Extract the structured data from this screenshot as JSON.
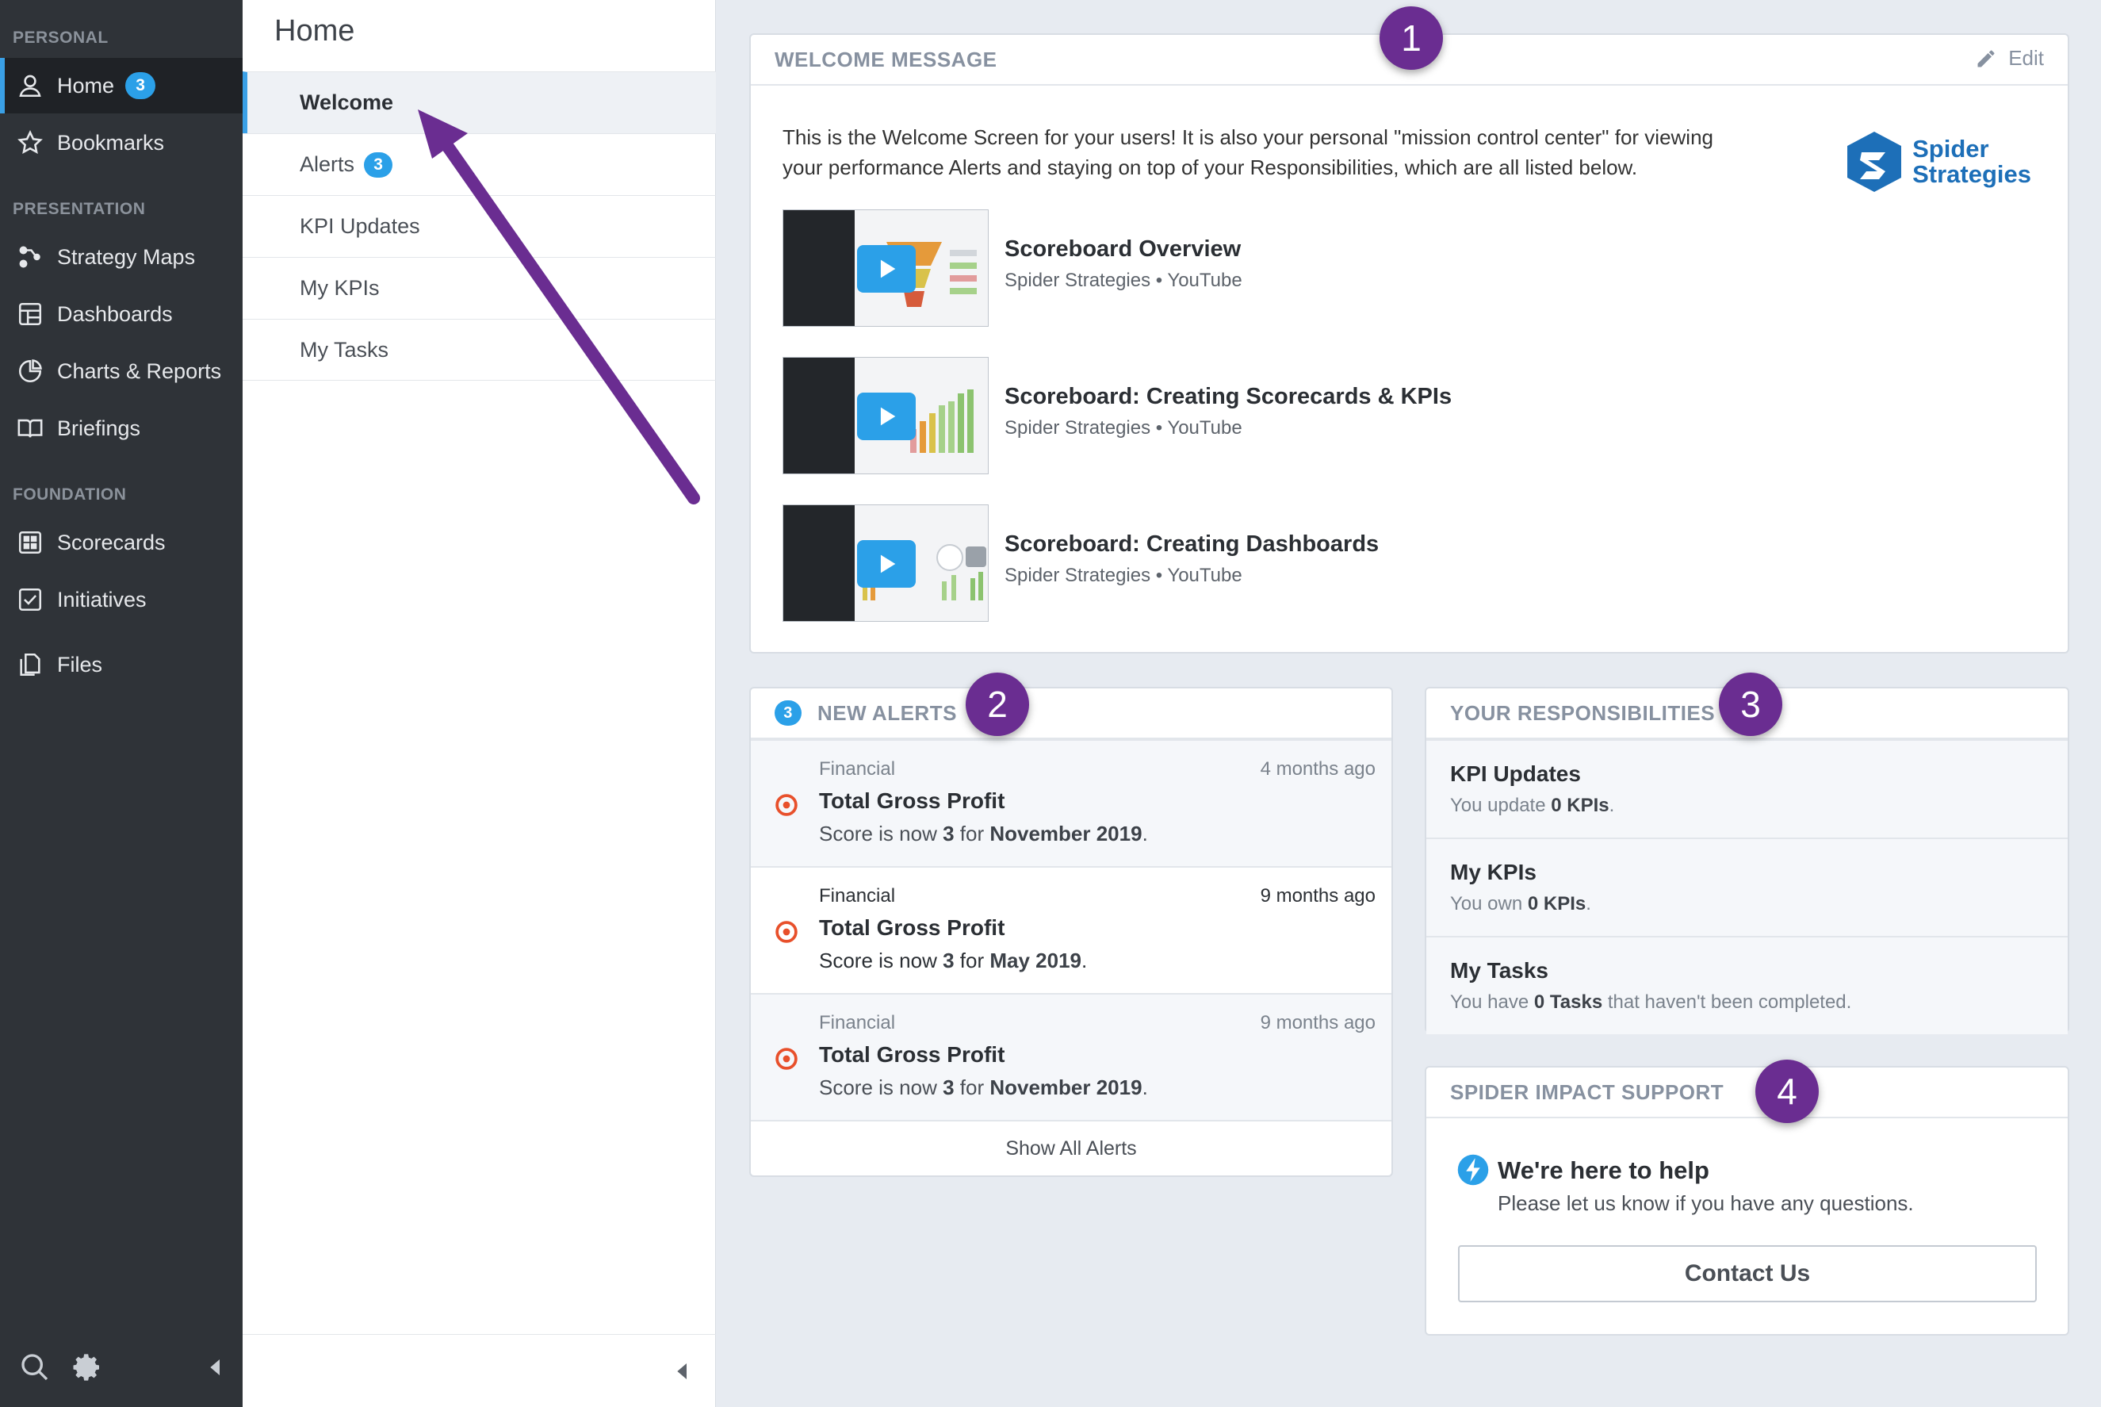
{
  "nav": {
    "sections": {
      "personal": "PERSONAL",
      "presentation": "PRESENTATION",
      "foundation": "FOUNDATION"
    },
    "items": {
      "home": {
        "label": "Home",
        "badge": "3"
      },
      "bookmarks": {
        "label": "Bookmarks"
      },
      "strategy_maps": {
        "label": "Strategy Maps"
      },
      "dashboards": {
        "label": "Dashboards"
      },
      "charts_reports": {
        "label": "Charts & Reports"
      },
      "briefings": {
        "label": "Briefings"
      },
      "scorecards": {
        "label": "Scorecards"
      },
      "initiatives": {
        "label": "Initiatives"
      },
      "files": {
        "label": "Files"
      }
    }
  },
  "subnav": {
    "title": "Home",
    "items": {
      "welcome": {
        "label": "Welcome"
      },
      "alerts": {
        "label": "Alerts",
        "badge": "3"
      },
      "kpi_updates": {
        "label": "KPI Updates"
      },
      "my_kpis": {
        "label": "My KPIs"
      },
      "my_tasks": {
        "label": "My Tasks"
      }
    }
  },
  "welcome": {
    "header": "WELCOME MESSAGE",
    "edit_label": "Edit",
    "text": "This is the Welcome Screen for your users!  It is also your personal \"mission control center\" for viewing your performance Alerts and staying on top of your Responsibilities, which are all listed below.",
    "logo": {
      "line1": "Spider",
      "line2": "Strategies"
    },
    "videos": [
      {
        "title": "Scoreboard Overview",
        "source": "Spider Strategies • YouTube"
      },
      {
        "title": "Scoreboard: Creating Scorecards & KPIs",
        "source": "Spider Strategies • YouTube"
      },
      {
        "title": "Scoreboard: Creating Dashboards",
        "source": "Spider Strategies • YouTube"
      }
    ]
  },
  "alerts": {
    "badge": "3",
    "header": "NEW ALERTS",
    "items": [
      {
        "category": "Financial",
        "time": "4 months ago",
        "title": "Total Gross Profit",
        "score_prefix": "Score is now ",
        "score": "3",
        "score_mid": " for ",
        "period": "November 2019",
        "score_suffix": "."
      },
      {
        "category": "Financial",
        "time": "9 months ago",
        "title": "Total Gross Profit",
        "score_prefix": "Score is now ",
        "score": "3",
        "score_mid": " for ",
        "period": "May 2019",
        "score_suffix": "."
      },
      {
        "category": "Financial",
        "time": "9 months ago",
        "title": "Total Gross Profit",
        "score_prefix": "Score is now ",
        "score": "3",
        "score_mid": " for ",
        "period": "November 2019",
        "score_suffix": "."
      }
    ],
    "show_all": "Show All Alerts"
  },
  "responsibilities": {
    "header": "YOUR RESPONSIBILITIES",
    "items": [
      {
        "title": "KPI Updates",
        "prefix": "You update ",
        "bold": "0 KPIs",
        "suffix": "."
      },
      {
        "title": "My KPIs",
        "prefix": "You own ",
        "bold": "0 KPIs",
        "suffix": "."
      },
      {
        "title": "My Tasks",
        "prefix": "You have ",
        "bold": "0 Tasks",
        "suffix": " that haven't been completed."
      }
    ]
  },
  "support": {
    "header": "SPIDER IMPACT SUPPORT",
    "title": "We're here to help",
    "subtitle": "Please let us know if you have any questions.",
    "button": "Contact Us"
  },
  "callouts": [
    "1",
    "2",
    "3",
    "4"
  ],
  "colors": {
    "accent": "#2ba0e8",
    "callout": "#6a2d91",
    "alert_icon": "#e8502b",
    "nav_bg": "#2f3338"
  }
}
